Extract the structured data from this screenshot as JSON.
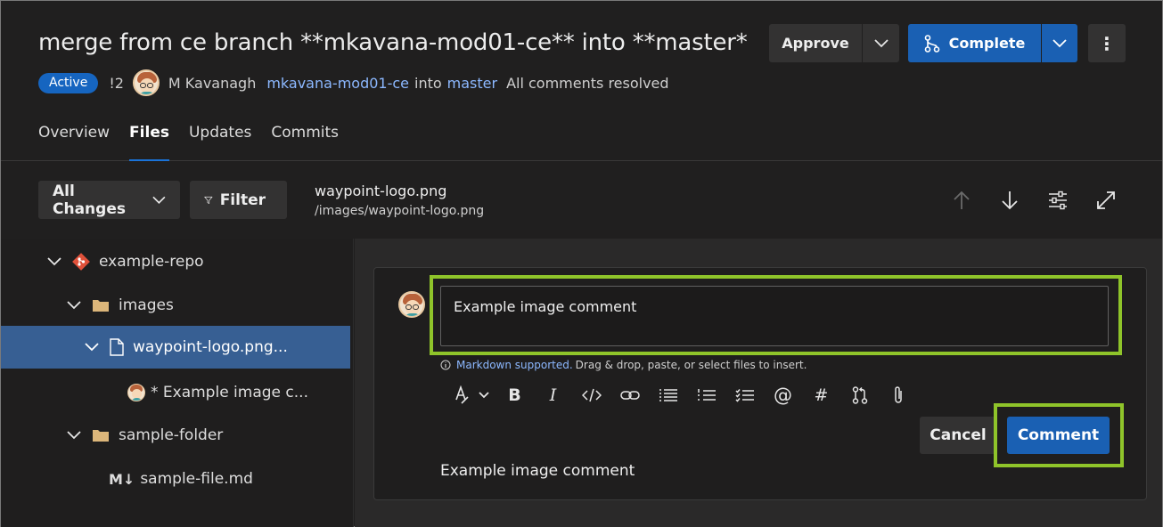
{
  "pr": {
    "title": "merge from ce branch **mkavana-mod01-ce** into **master*",
    "status": "Active",
    "id": "!2",
    "author": "M Kavanagh",
    "source_branch": "mkavana-mod01-ce",
    "into": "into",
    "target_branch": "master",
    "comments_status": "All comments resolved"
  },
  "actions": {
    "approve": "Approve",
    "complete": "Complete",
    "more": "⋮"
  },
  "tabs": [
    {
      "label": "Overview",
      "active": false
    },
    {
      "label": "Files",
      "active": true
    },
    {
      "label": "Updates",
      "active": false
    },
    {
      "label": "Commits",
      "active": false
    }
  ],
  "toolbar": {
    "changes_label": "All Changes",
    "filter_label": "Filter",
    "file_name": "waypoint-logo.png",
    "file_path": "/images/waypoint-logo.png"
  },
  "tree": {
    "repo": "example-repo",
    "folder_images": "images",
    "file_selected": "waypoint-logo.png...",
    "comment_item": "* Example image c...",
    "folder_sample": "sample-folder",
    "file_md": "sample-file.md",
    "md_icon": "M↓"
  },
  "comment": {
    "input_value": "Example image comment",
    "markdown_link": "Markdown supported.",
    "help_text": "Drag & drop, paste, or select files to insert.",
    "cancel": "Cancel",
    "submit": "Comment",
    "posted_text": "Example image comment"
  },
  "colors": {
    "accent": "#1a60b3",
    "highlight": "#8fc42a",
    "selected_row": "#375f93"
  }
}
